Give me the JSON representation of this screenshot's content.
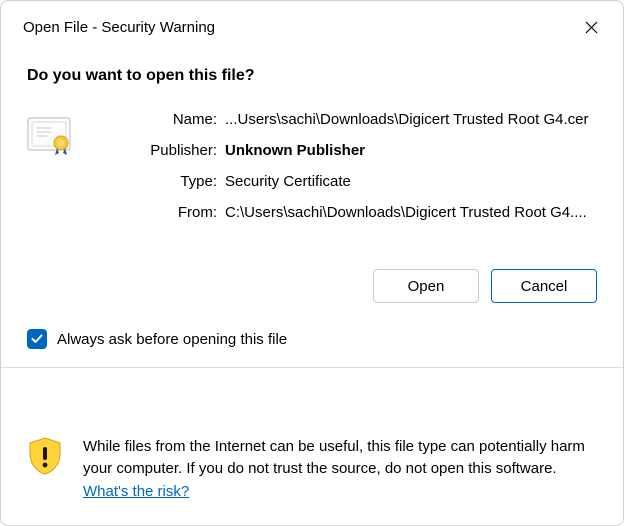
{
  "title": "Open File - Security Warning",
  "heading": "Do you want to open this file?",
  "fields": {
    "name_label": "Name:",
    "name_value": "...Users\\sachi\\Downloads\\Digicert Trusted Root G4.cer",
    "publisher_label": "Publisher:",
    "publisher_value": "Unknown Publisher",
    "type_label": "Type:",
    "type_value": "Security Certificate",
    "from_label": "From:",
    "from_value": "C:\\Users\\sachi\\Downloads\\Digicert Trusted Root G4...."
  },
  "buttons": {
    "open": "Open",
    "cancel": "Cancel"
  },
  "checkbox_label": "Always ask before opening this file",
  "footer_text": "While files from the Internet can be useful, this file type can potentially harm your computer. If you do not trust the source, do not open this software. ",
  "footer_link": "What's the risk?"
}
